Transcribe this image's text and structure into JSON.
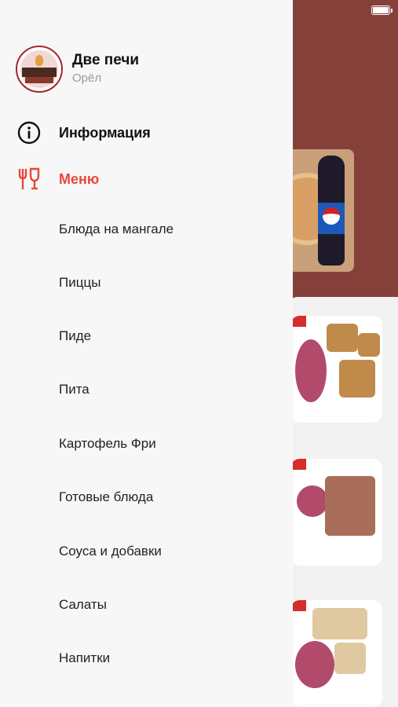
{
  "restaurant": {
    "name": "Две печи",
    "city": "Орёл"
  },
  "nav": {
    "info_label": "Информация",
    "menu_label": "Меню"
  },
  "categories": [
    "Блюда на мангале",
    "Пиццы",
    "Пиде",
    "Пита",
    "Картофель Фри",
    "Готовые блюда",
    "Соуса и добавки",
    "Салаты",
    "Напитки"
  ],
  "icons": {
    "info": "info-circle-icon",
    "menu": "fork-glass-icon"
  },
  "colors": {
    "accent": "#e8473b",
    "drawer_bg": "#f7f7f7",
    "backdrop": "#86403a"
  }
}
